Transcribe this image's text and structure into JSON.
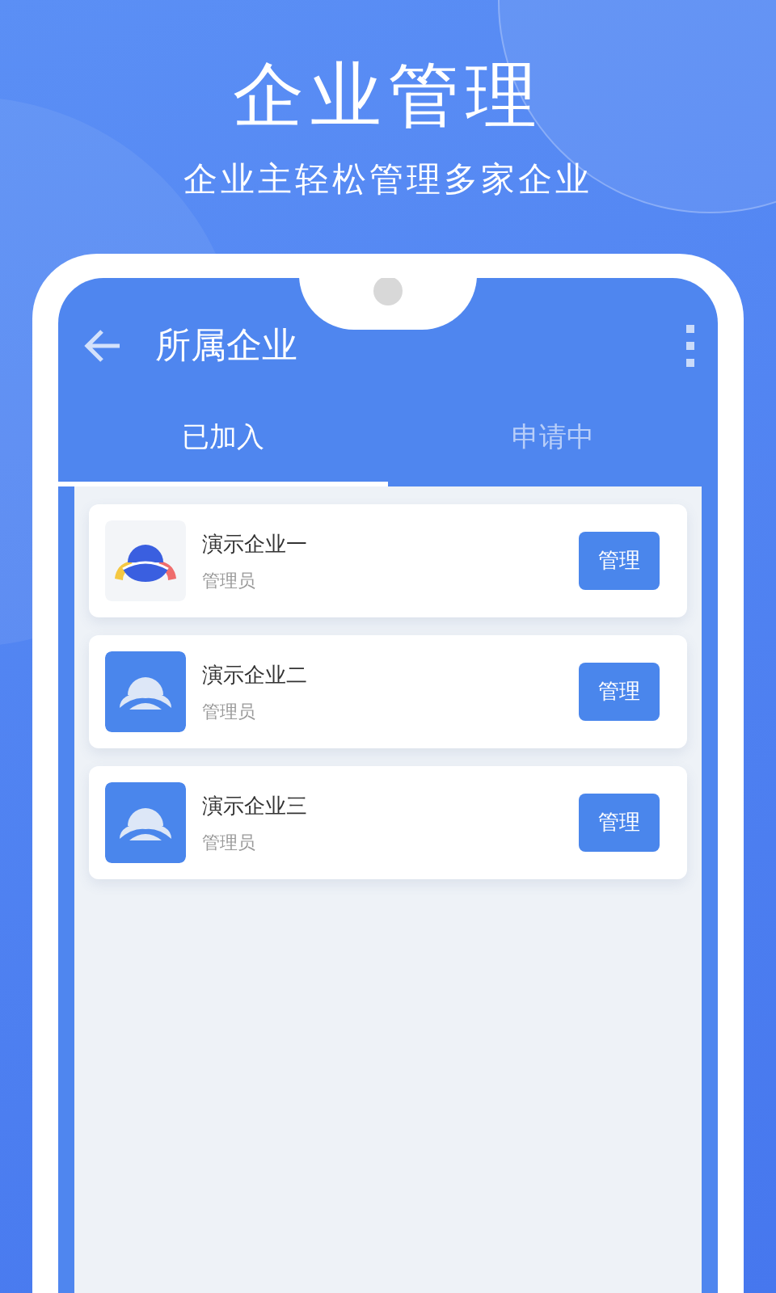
{
  "headline": "企业管理",
  "subtitle": "企业主轻松管理多家企业",
  "app_bar": {
    "title": "所属企业"
  },
  "tabs": [
    {
      "label": "已加入",
      "selected": true
    },
    {
      "label": "申请中",
      "selected": false
    }
  ],
  "companies": [
    {
      "name": "演示企业一",
      "role": "管理员",
      "kind": "multicolor",
      "action": "管理"
    },
    {
      "name": "演示企业二",
      "role": "管理员",
      "kind": "mono",
      "action": "管理"
    },
    {
      "name": "演示企业三",
      "role": "管理员",
      "kind": "mono",
      "action": "管理"
    }
  ]
}
